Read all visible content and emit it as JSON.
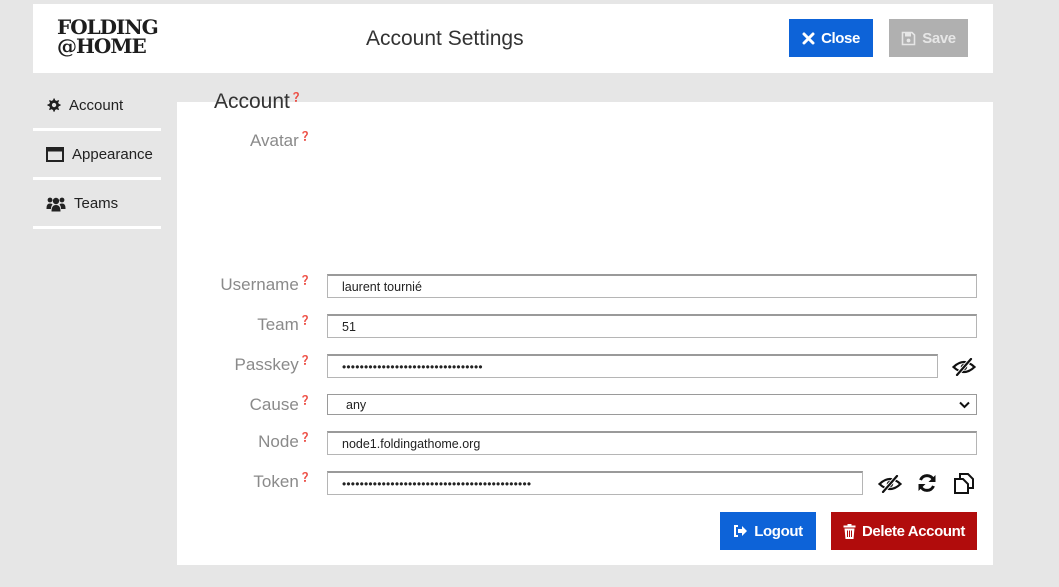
{
  "header": {
    "logo_line1": "FOLDING",
    "logo_line2": "@HOME",
    "title": "Account Settings",
    "close_label": "Close",
    "save_label": "Save"
  },
  "sidebar": {
    "items": [
      {
        "label": "Account",
        "icon": "gear-icon"
      },
      {
        "label": "Appearance",
        "icon": "window-icon"
      },
      {
        "label": "Teams",
        "icon": "users-icon"
      }
    ]
  },
  "account": {
    "section_title": "Account",
    "help_glyph": "❓",
    "avatar_label": "Avatar",
    "username_label": "Username",
    "username_value": "laurent tournié",
    "team_label": "Team",
    "team_value": "51",
    "passkey_label": "Passkey",
    "passkey_value": "••••••••••••••••••••••••••••••••",
    "cause_label": "Cause",
    "cause_value": "any",
    "node_label": "Node",
    "node_value": "node1.foldingathome.org",
    "token_label": "Token",
    "token_value": "•••••••••••••••••••••••••••••••••••••••••••",
    "logout_label": "Logout",
    "delete_label": "Delete Account"
  },
  "colors": {
    "primary": "#0d63d8",
    "danger": "#b10c0c",
    "disabled": "#b0b0b0",
    "background": "#e6e6e6"
  }
}
